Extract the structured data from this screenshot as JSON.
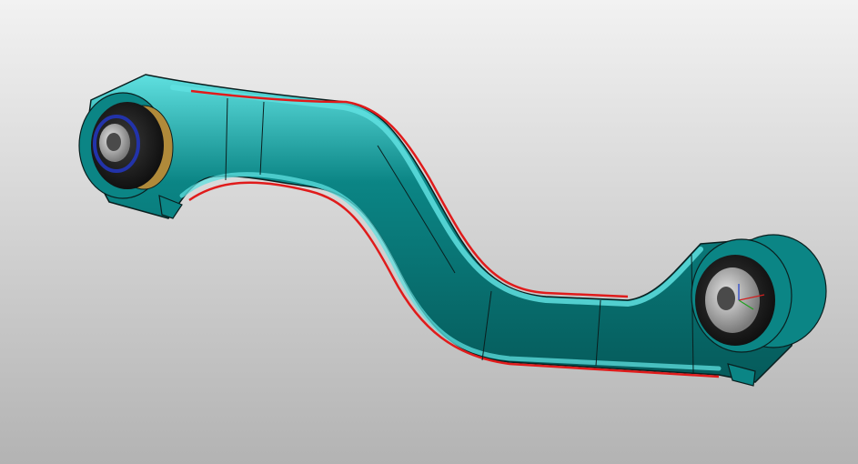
{
  "viewport": {
    "background_top": "#f2f2f2",
    "background_bottom": "#b3b3b3"
  },
  "model": {
    "part": "suspension-control-arm",
    "body_color": "#0b8585",
    "body_highlight_color": "#5fe0e0",
    "body_shadow_color": "#055a5a",
    "edge_color": "#0a1f1f",
    "stripe_color": "#e01b1b",
    "bushing_rubber_color": "#1a1a1a",
    "bushing_sleeve_color": "#b8b8b8",
    "left_bushing_ring_color": "#2233aa",
    "left_bushing_collar_color": "#b08a3a",
    "triad_colors": [
      "#d02020",
      "#20a020",
      "#2040d0"
    ]
  }
}
